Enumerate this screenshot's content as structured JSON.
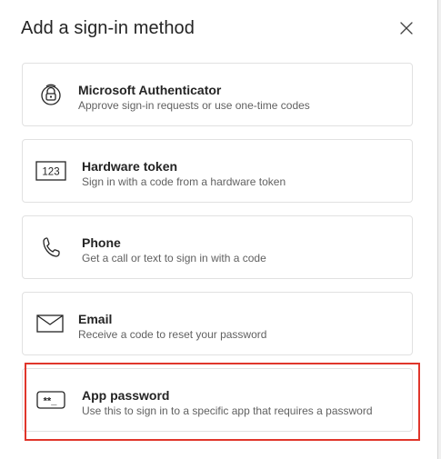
{
  "dialog": {
    "title": "Add a sign-in method",
    "close_icon": "close-icon"
  },
  "methods": [
    {
      "name": "Microsoft Authenticator",
      "description": "Approve sign-in requests or use one-time codes",
      "icon": "authenticator-lock-icon"
    },
    {
      "name": "Hardware token",
      "description": "Sign in with a code from a hardware token",
      "icon": "hardware-token-icon",
      "icon_text": "123"
    },
    {
      "name": "Phone",
      "description": "Get a call or text to sign in with a code",
      "icon": "phone-icon"
    },
    {
      "name": "Email",
      "description": "Receive a code to reset your password",
      "icon": "mail-icon"
    },
    {
      "name": "App password",
      "description": "Use this to sign in to a specific app that requires a password",
      "icon": "app-password-icon",
      "icon_text": "**_",
      "highlighted": true
    }
  ],
  "colors": {
    "highlight_border": "#e0362b",
    "card_border": "#e1e1e1",
    "text_primary": "#242424",
    "text_secondary": "#616161"
  }
}
